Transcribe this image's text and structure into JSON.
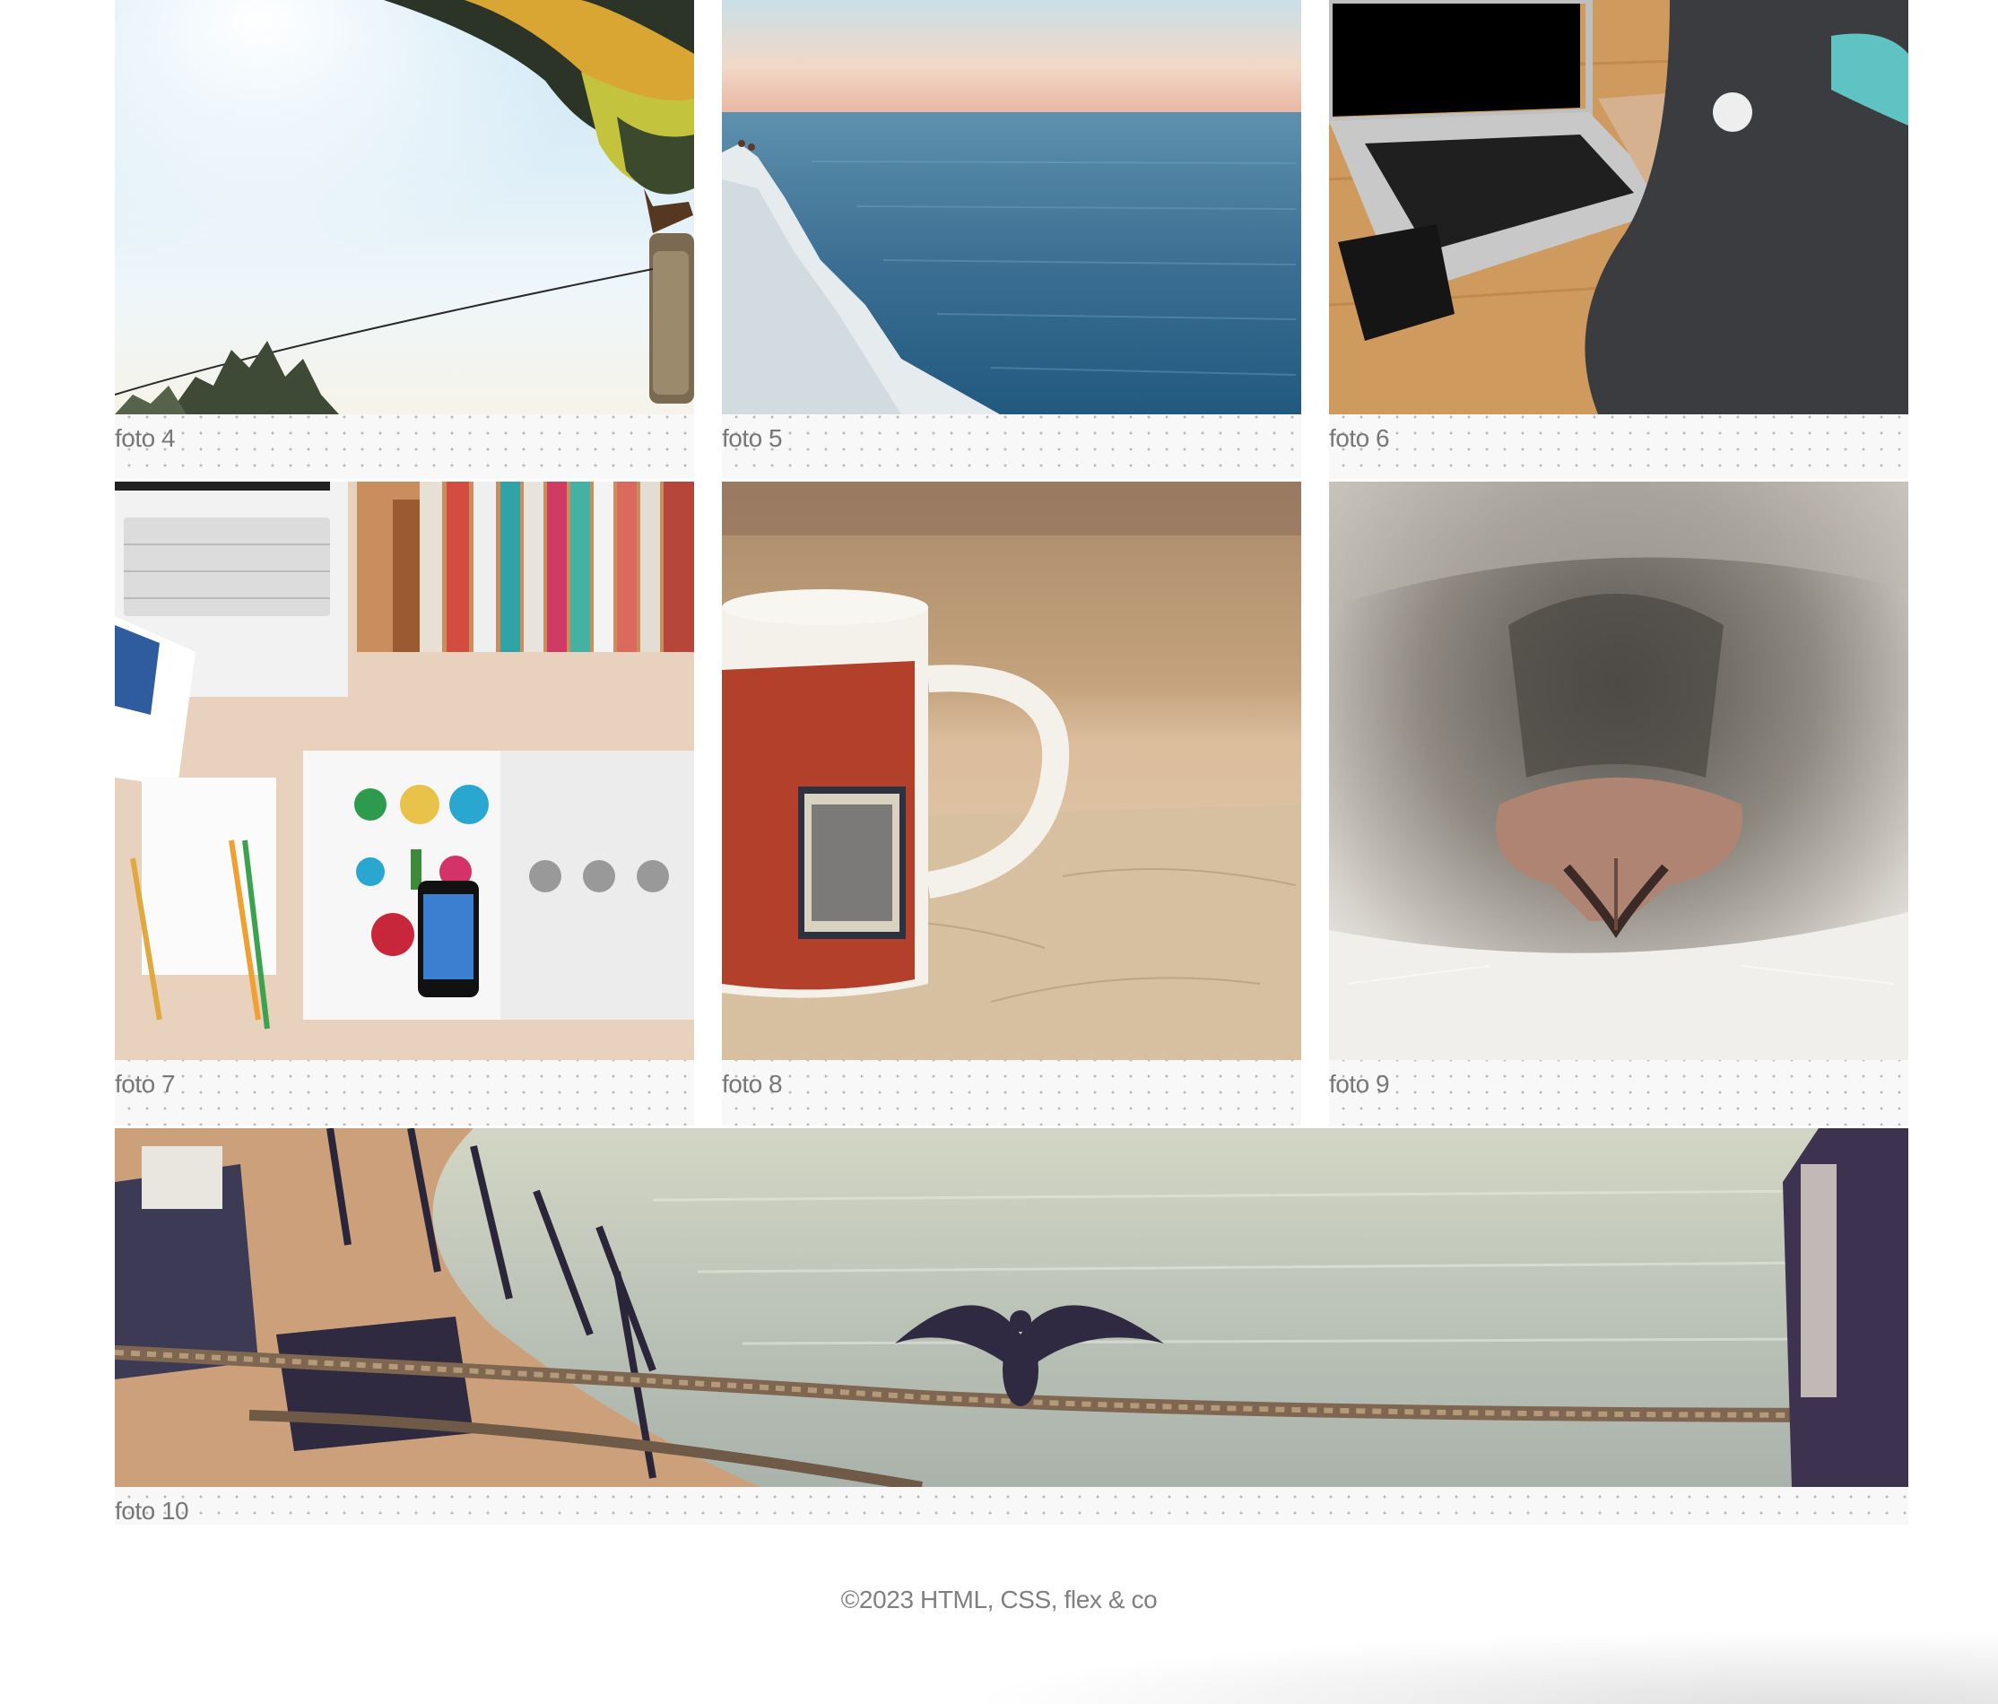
{
  "gallery": {
    "items": [
      {
        "caption": "foto 4",
        "subject": "hot-air balloon over treetops"
      },
      {
        "caption": "foto 5",
        "subject": "white cliff over calm sea"
      },
      {
        "caption": "foto 6",
        "subject": "hands typing on a laptop"
      },
      {
        "caption": "foto 7",
        "subject": "desk with laptop, books and logo sketches"
      },
      {
        "caption": "foto 8",
        "subject": "mug with Cuba stamp print"
      },
      {
        "caption": "foto 9",
        "subject": "close-up of a cat nose"
      },
      {
        "caption": "foto 10",
        "subject": "cormorant spreading wings on a rope at a pier"
      }
    ]
  },
  "footer": {
    "text": "©2023 HTML, CSS, flex & co"
  },
  "colors": {
    "caption_text": "#777777",
    "footer_text": "#808080",
    "figure_background": "#f8f8f8",
    "dot_pattern": "#b9b9b9"
  }
}
